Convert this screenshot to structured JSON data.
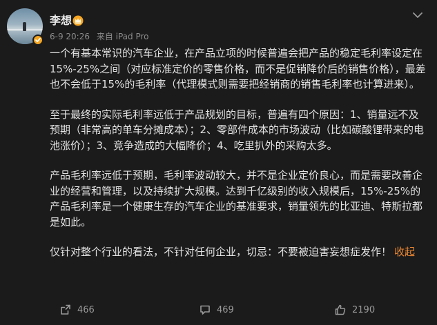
{
  "post": {
    "author": "李想",
    "meta": {
      "time": "6-9 20:26",
      "source": "来自 iPad Pro"
    },
    "paragraphs": [
      "一个有基本常识的汽车企业，在产品立项的时候普遍会把产品的稳定毛利率设定在15%-25%之间（对应标准定价的零售价格，而不是促销降价后的销售价格），最差也不会低于15%的毛利率（代理模式则需要把经销商的销售毛利率也计算进来）。",
      "至于最终的实际毛利率远低于产品规划的目标，普遍有四个原因：1、销量远不及预期（非常高的单车分摊成本）；2、零部件成本的市场波动（比如碳酸锂带来的电池涨价）；3、竞争造成的大幅降价；4、吃里扒外的采购太多。",
      "产品毛利率远低于预期，毛利率波动较大，并不是企业定价良心，而是需要改善企业的经营和管理，以及持续扩大规模。达到千亿级别的收入规模后，15%-25%的产品毛利率是一个健康生存的汽车企业的基准要求，销量领先的比亚迪、特斯拉都是如此。",
      "仅针对整个行业的看法，不针对任何企业，切忌：不要被迫害妄想症发作！"
    ],
    "collapse_label": "收起",
    "actions": {
      "repost_count": "466",
      "comment_count": "469",
      "like_count": "2190"
    }
  },
  "colors": {
    "background": "#1b1b1b",
    "text": "#e2e2e2",
    "meta": "#8c8c8c",
    "accent": "#f18a33",
    "verified": "#f5a623"
  },
  "icons": [
    "verified-badge-icon",
    "vip-crown-icon",
    "more-chevron-icon",
    "repost-icon",
    "comment-icon",
    "like-icon"
  ]
}
